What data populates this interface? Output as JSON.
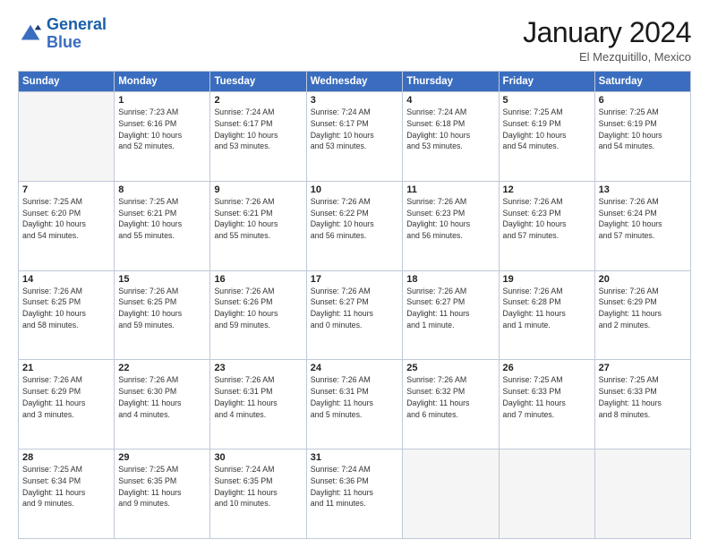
{
  "logo": {
    "line1": "General",
    "line2": "Blue"
  },
  "title": {
    "month": "January 2024",
    "location": "El Mezquitillo, Mexico"
  },
  "weekdays": [
    "Sunday",
    "Monday",
    "Tuesday",
    "Wednesday",
    "Thursday",
    "Friday",
    "Saturday"
  ],
  "weeks": [
    [
      {
        "day": "",
        "info": ""
      },
      {
        "day": "1",
        "info": "Sunrise: 7:23 AM\nSunset: 6:16 PM\nDaylight: 10 hours\nand 52 minutes."
      },
      {
        "day": "2",
        "info": "Sunrise: 7:24 AM\nSunset: 6:17 PM\nDaylight: 10 hours\nand 53 minutes."
      },
      {
        "day": "3",
        "info": "Sunrise: 7:24 AM\nSunset: 6:17 PM\nDaylight: 10 hours\nand 53 minutes."
      },
      {
        "day": "4",
        "info": "Sunrise: 7:24 AM\nSunset: 6:18 PM\nDaylight: 10 hours\nand 53 minutes."
      },
      {
        "day": "5",
        "info": "Sunrise: 7:25 AM\nSunset: 6:19 PM\nDaylight: 10 hours\nand 54 minutes."
      },
      {
        "day": "6",
        "info": "Sunrise: 7:25 AM\nSunset: 6:19 PM\nDaylight: 10 hours\nand 54 minutes."
      }
    ],
    [
      {
        "day": "7",
        "info": "Sunrise: 7:25 AM\nSunset: 6:20 PM\nDaylight: 10 hours\nand 54 minutes."
      },
      {
        "day": "8",
        "info": "Sunrise: 7:25 AM\nSunset: 6:21 PM\nDaylight: 10 hours\nand 55 minutes."
      },
      {
        "day": "9",
        "info": "Sunrise: 7:26 AM\nSunset: 6:21 PM\nDaylight: 10 hours\nand 55 minutes."
      },
      {
        "day": "10",
        "info": "Sunrise: 7:26 AM\nSunset: 6:22 PM\nDaylight: 10 hours\nand 56 minutes."
      },
      {
        "day": "11",
        "info": "Sunrise: 7:26 AM\nSunset: 6:23 PM\nDaylight: 10 hours\nand 56 minutes."
      },
      {
        "day": "12",
        "info": "Sunrise: 7:26 AM\nSunset: 6:23 PM\nDaylight: 10 hours\nand 57 minutes."
      },
      {
        "day": "13",
        "info": "Sunrise: 7:26 AM\nSunset: 6:24 PM\nDaylight: 10 hours\nand 57 minutes."
      }
    ],
    [
      {
        "day": "14",
        "info": "Sunrise: 7:26 AM\nSunset: 6:25 PM\nDaylight: 10 hours\nand 58 minutes."
      },
      {
        "day": "15",
        "info": "Sunrise: 7:26 AM\nSunset: 6:25 PM\nDaylight: 10 hours\nand 59 minutes."
      },
      {
        "day": "16",
        "info": "Sunrise: 7:26 AM\nSunset: 6:26 PM\nDaylight: 10 hours\nand 59 minutes."
      },
      {
        "day": "17",
        "info": "Sunrise: 7:26 AM\nSunset: 6:27 PM\nDaylight: 11 hours\nand 0 minutes."
      },
      {
        "day": "18",
        "info": "Sunrise: 7:26 AM\nSunset: 6:27 PM\nDaylight: 11 hours\nand 1 minute."
      },
      {
        "day": "19",
        "info": "Sunrise: 7:26 AM\nSunset: 6:28 PM\nDaylight: 11 hours\nand 1 minute."
      },
      {
        "day": "20",
        "info": "Sunrise: 7:26 AM\nSunset: 6:29 PM\nDaylight: 11 hours\nand 2 minutes."
      }
    ],
    [
      {
        "day": "21",
        "info": "Sunrise: 7:26 AM\nSunset: 6:29 PM\nDaylight: 11 hours\nand 3 minutes."
      },
      {
        "day": "22",
        "info": "Sunrise: 7:26 AM\nSunset: 6:30 PM\nDaylight: 11 hours\nand 4 minutes."
      },
      {
        "day": "23",
        "info": "Sunrise: 7:26 AM\nSunset: 6:31 PM\nDaylight: 11 hours\nand 4 minutes."
      },
      {
        "day": "24",
        "info": "Sunrise: 7:26 AM\nSunset: 6:31 PM\nDaylight: 11 hours\nand 5 minutes."
      },
      {
        "day": "25",
        "info": "Sunrise: 7:26 AM\nSunset: 6:32 PM\nDaylight: 11 hours\nand 6 minutes."
      },
      {
        "day": "26",
        "info": "Sunrise: 7:25 AM\nSunset: 6:33 PM\nDaylight: 11 hours\nand 7 minutes."
      },
      {
        "day": "27",
        "info": "Sunrise: 7:25 AM\nSunset: 6:33 PM\nDaylight: 11 hours\nand 8 minutes."
      }
    ],
    [
      {
        "day": "28",
        "info": "Sunrise: 7:25 AM\nSunset: 6:34 PM\nDaylight: 11 hours\nand 9 minutes."
      },
      {
        "day": "29",
        "info": "Sunrise: 7:25 AM\nSunset: 6:35 PM\nDaylight: 11 hours\nand 9 minutes."
      },
      {
        "day": "30",
        "info": "Sunrise: 7:24 AM\nSunset: 6:35 PM\nDaylight: 11 hours\nand 10 minutes."
      },
      {
        "day": "31",
        "info": "Sunrise: 7:24 AM\nSunset: 6:36 PM\nDaylight: 11 hours\nand 11 minutes."
      },
      {
        "day": "",
        "info": ""
      },
      {
        "day": "",
        "info": ""
      },
      {
        "day": "",
        "info": ""
      }
    ]
  ]
}
